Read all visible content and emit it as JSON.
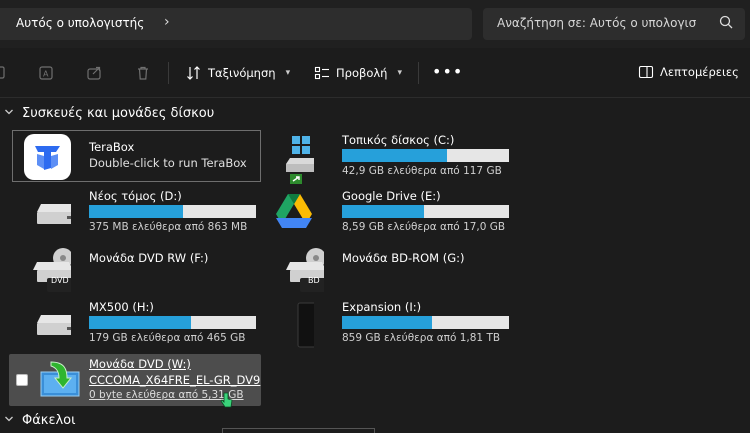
{
  "address": {
    "location": "Αυτός ο υπολογιστής",
    "separator": "›"
  },
  "search": {
    "placeholder": "Αναζήτηση σε: Αυτός ο υπολογισ"
  },
  "toolbar": {
    "sort_label": "Ταξινόμηση",
    "view_label": "Προβολή",
    "more_label": "•••",
    "details_label": "Λεπτομέρειες"
  },
  "sections": {
    "devices_title": "Συσκευές και μονάδες δίσκου",
    "folders_title": "Φάκελοι"
  },
  "terabox": {
    "name": "TeraBox",
    "subtitle": "Double-click to run TeraBox"
  },
  "drives": {
    "c": {
      "name": "Τοπικός δίσκος (C:)",
      "free": "42,9 GB ελεύθερα από 117 GB",
      "used_fraction": 0.63
    },
    "d": {
      "name": "Νέος τόμος (D:)",
      "free": "375 MB ελεύθερα από 863 MB",
      "used_fraction": 0.56
    },
    "e": {
      "name": "Google Drive (E:)",
      "free": "8,59 GB ελεύθερα από 17,0 GB",
      "used_fraction": 0.49
    },
    "f": {
      "name": "Μονάδα DVD RW (F:)",
      "badge": "DVD"
    },
    "g": {
      "name": "Μονάδα BD-ROM (G:)",
      "badge": "BD"
    },
    "h": {
      "name": "MX500 (H:)",
      "free": "179 GB ελεύθερα από 465 GB",
      "used_fraction": 0.61
    },
    "i": {
      "name": "Expansion (I:)",
      "free": "859 GB ελεύθερα από 1,81 TB",
      "used_fraction": 0.54
    },
    "w": {
      "name": "Μονάδα DVD (W:)",
      "label": "CCCOMA_X64FRE_EL-GR_DV9",
      "free": "0 byte ελεύθερα από 5,31 GB"
    }
  },
  "colors": {
    "bar_fill": "#26a0da",
    "bar_track": "#e6e6e6",
    "selection": "#4d4d4d"
  }
}
